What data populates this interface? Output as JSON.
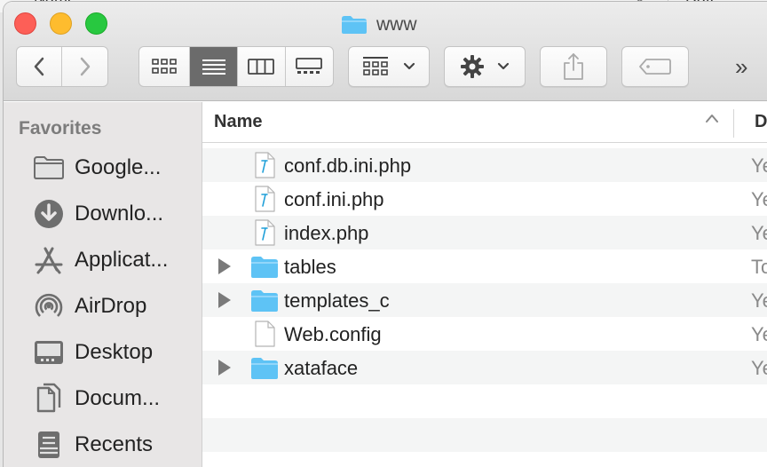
{
  "background_window": {
    "col_name": "Name",
    "col_date": "Date Modified"
  },
  "window": {
    "title": "www",
    "title_icon": "folder-icon"
  },
  "toolbar": {
    "back_icon": "chevron-left-icon",
    "forward_icon": "chevron-right-icon",
    "views": [
      {
        "icon": "icon-view-icon",
        "active": false
      },
      {
        "icon": "list-view-icon",
        "active": true
      },
      {
        "icon": "column-view-icon",
        "active": false
      },
      {
        "icon": "gallery-view-icon",
        "active": false
      }
    ],
    "group_icon": "group-by-icon",
    "action_icon": "gear-icon",
    "share_icon": "share-icon",
    "tag_icon": "tag-icon",
    "overflow_label": "»"
  },
  "sidebar": {
    "heading": "Favorites",
    "items": [
      {
        "label": "Google...",
        "icon": "folder-icon"
      },
      {
        "label": "Downlo...",
        "icon": "download-icon"
      },
      {
        "label": "Applicat...",
        "icon": "applications-icon"
      },
      {
        "label": "AirDrop",
        "icon": "airdrop-icon"
      },
      {
        "label": "Desktop",
        "icon": "desktop-icon"
      },
      {
        "label": "Docum...",
        "icon": "documents-icon"
      },
      {
        "label": "Recents",
        "icon": "recents-icon"
      }
    ]
  },
  "list": {
    "col_name": "Name",
    "col_date": "D",
    "rows": [
      {
        "name": "conf.db.ini.php",
        "type": "php-file",
        "expandable": false,
        "date": "Ye"
      },
      {
        "name": "conf.ini.php",
        "type": "php-file",
        "expandable": false,
        "date": "Ye"
      },
      {
        "name": "index.php",
        "type": "php-file",
        "expandable": false,
        "date": "Ye"
      },
      {
        "name": "tables",
        "type": "folder",
        "expandable": true,
        "date": "To"
      },
      {
        "name": "templates_c",
        "type": "folder",
        "expandable": true,
        "date": "Ye"
      },
      {
        "name": "Web.config",
        "type": "document",
        "expandable": false,
        "date": "Ye"
      },
      {
        "name": "xataface",
        "type": "folder",
        "expandable": true,
        "date": "Ye"
      }
    ]
  },
  "colors": {
    "folder": "#5ec3f5",
    "close": "#fd5f57",
    "minimize": "#febc2e",
    "maximize": "#28c840"
  }
}
